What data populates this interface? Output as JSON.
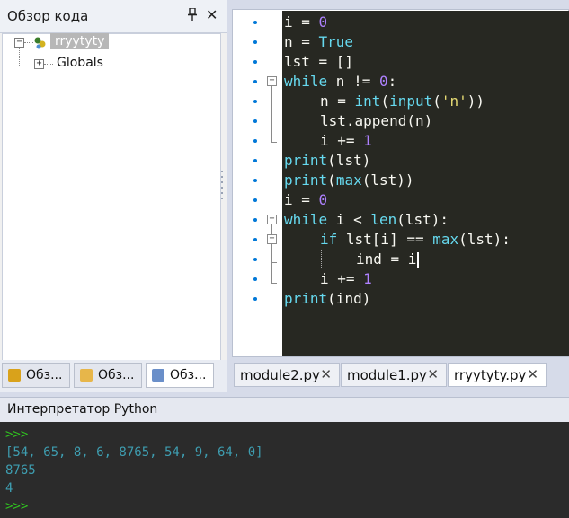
{
  "code_overview": {
    "title": "Обзор кода",
    "pin_icon": "pin-icon",
    "close_icon": "close-icon",
    "tree": {
      "root_label": "rryytyty",
      "child_label": "Globals"
    },
    "tabs": [
      {
        "label": "Обз...",
        "icon": "folder-icon",
        "color": "#d9a21b"
      },
      {
        "label": "Обз...",
        "icon": "package-icon",
        "color": "#e7b64a"
      },
      {
        "label": "Обз...",
        "icon": "overview-icon",
        "color": "#6a8fc9"
      }
    ]
  },
  "editor": {
    "lines": [
      {
        "text": "i = 0",
        "indent": 0
      },
      {
        "text": "n = True",
        "indent": 0
      },
      {
        "text": "lst = []",
        "indent": 0
      },
      {
        "text": "while n != 0:",
        "indent": 0
      },
      {
        "text": "n = int(input('n'))",
        "indent": 1
      },
      {
        "text": "lst.append(n)",
        "indent": 1
      },
      {
        "text": "i += 1",
        "indent": 1
      },
      {
        "text": "print(lst)",
        "indent": 0
      },
      {
        "text": "print(max(lst))",
        "indent": 0
      },
      {
        "text": "i = 0",
        "indent": 0
      },
      {
        "text": "while i < len(lst):",
        "indent": 0
      },
      {
        "text": "if lst[i] == max(lst):",
        "indent": 1
      },
      {
        "text": "ind = i",
        "indent": 2
      },
      {
        "text": "i += 1",
        "indent": 1
      },
      {
        "text": "print(ind)",
        "indent": 0
      }
    ],
    "tabs": [
      {
        "label": "module2.py",
        "active": false
      },
      {
        "label": "module1.py",
        "active": false
      },
      {
        "label": "rryytyty.py",
        "active": true
      }
    ],
    "tab_close_glyph": "✕"
  },
  "interpreter": {
    "title": "Интерпретатор Python",
    "lines": [
      {
        "text": ">>>",
        "kind": "prompt"
      },
      {
        "text": "[54, 65, 8, 6, 8765, 54, 9, 64, 0]",
        "kind": "output"
      },
      {
        "text": "8765",
        "kind": "output"
      },
      {
        "text": "4",
        "kind": "output"
      },
      {
        "text": ">>>",
        "kind": "prompt"
      }
    ]
  },
  "colors": {
    "editor_bg": "#272822",
    "console_bg": "#2b2b2b",
    "prompt": "#30c020",
    "output": "#3e9db0",
    "keyword": "#66d9ef",
    "number": "#ae81ff",
    "string": "#e6db74",
    "accent": "#0078d7"
  }
}
